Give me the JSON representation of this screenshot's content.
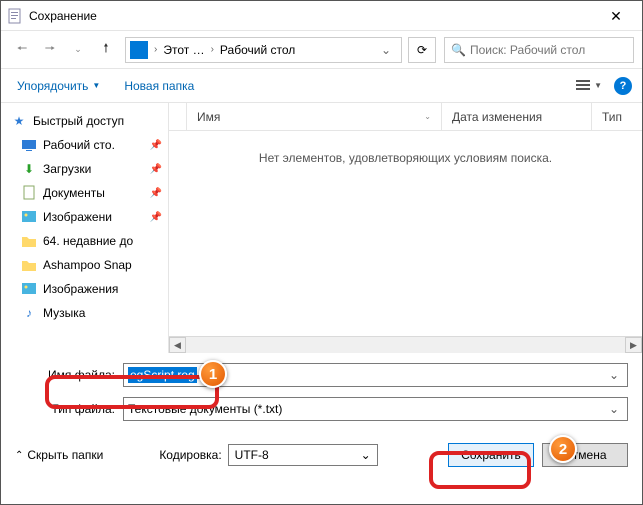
{
  "window": {
    "title": "Сохранение"
  },
  "nav": {
    "path": {
      "seg1": "Этот …",
      "seg2": "Рабочий стол"
    },
    "search_placeholder": "Поиск: Рабочий стол"
  },
  "toolbar": {
    "organize": "Упорядочить",
    "newfolder": "Новая папка"
  },
  "sidebar": {
    "items": [
      {
        "label": "Быстрый доступ"
      },
      {
        "label": "Рабочий сто."
      },
      {
        "label": "Загрузки"
      },
      {
        "label": "Документы"
      },
      {
        "label": "Изображени"
      },
      {
        "label": "64. недавние до"
      },
      {
        "label": "Ashampoo Snap"
      },
      {
        "label": "Изображения"
      },
      {
        "label": "Музыка"
      }
    ]
  },
  "columns": {
    "name": "Имя",
    "date": "Дата изменения",
    "type": "Тип"
  },
  "empty_text": "Нет элементов, удовлетворяющих условиям поиска.",
  "form": {
    "filename_label": "Имя файла:",
    "filename_value": "egScript.reg",
    "filetype_label": "Тип файла:",
    "filetype_value": "Текстовые документы (*.txt)"
  },
  "footer": {
    "hide_folders": "Скрыть папки",
    "encoding_label": "Кодировка:",
    "encoding_value": "UTF-8",
    "save": "Сохранить",
    "cancel": "Отмена"
  },
  "callouts": {
    "one": "1",
    "two": "2"
  }
}
